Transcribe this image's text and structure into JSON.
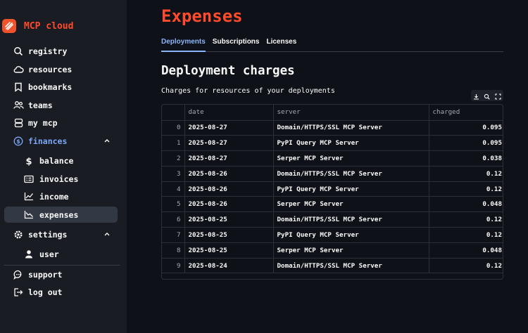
{
  "app": {
    "name": "MCP cloud",
    "accent": "#ff4b2b"
  },
  "sidebar": {
    "items": [
      {
        "label": "registry",
        "icon": "search-icon"
      },
      {
        "label": "resources",
        "icon": "cloud-icon"
      },
      {
        "label": "bookmarks",
        "icon": "bookmark-icon"
      },
      {
        "label": "teams",
        "icon": "users-icon"
      },
      {
        "label": "my mcp",
        "icon": "database-icon"
      },
      {
        "label": "finances",
        "icon": "dollar-circle-icon"
      },
      {
        "label": "balance",
        "icon": "dollar-icon"
      },
      {
        "label": "invoices",
        "icon": "receipt-icon"
      },
      {
        "label": "income",
        "icon": "chart-up-icon"
      },
      {
        "label": "expenses",
        "icon": "chart-down-icon"
      },
      {
        "label": "settings",
        "icon": "gear-icon"
      },
      {
        "label": "user",
        "icon": "user-icon"
      },
      {
        "label": "support",
        "icon": "chat-icon"
      },
      {
        "label": "log out",
        "icon": "logout-icon"
      }
    ]
  },
  "main": {
    "title": "Expenses",
    "tabs": [
      "Deployments",
      "Subscriptions",
      "Licenses"
    ],
    "active_tab": "Deployments",
    "section_title": "Deployment charges",
    "section_desc": "Charges for resources of your deployments",
    "table": {
      "columns": [
        "",
        "date",
        "server",
        "charged"
      ],
      "rows": [
        [
          "0",
          "2025-08-27",
          "Domain/HTTPS/SSL MCP Server",
          "0.095"
        ],
        [
          "1",
          "2025-08-27",
          "PyPI Query MCP Server",
          "0.095"
        ],
        [
          "2",
          "2025-08-27",
          "Serper MCP Server",
          "0.038"
        ],
        [
          "3",
          "2025-08-26",
          "Domain/HTTPS/SSL MCP Server",
          "0.12"
        ],
        [
          "4",
          "2025-08-26",
          "PyPI Query MCP Server",
          "0.12"
        ],
        [
          "5",
          "2025-08-26",
          "Serper MCP Server",
          "0.048"
        ],
        [
          "6",
          "2025-08-25",
          "Domain/HTTPS/SSL MCP Server",
          "0.12"
        ],
        [
          "7",
          "2025-08-25",
          "PyPI Query MCP Server",
          "0.12"
        ],
        [
          "8",
          "2025-08-25",
          "Serper MCP Server",
          "0.048"
        ],
        [
          "9",
          "2025-08-24",
          "Domain/HTTPS/SSL MCP Server",
          "0.12"
        ]
      ]
    }
  }
}
